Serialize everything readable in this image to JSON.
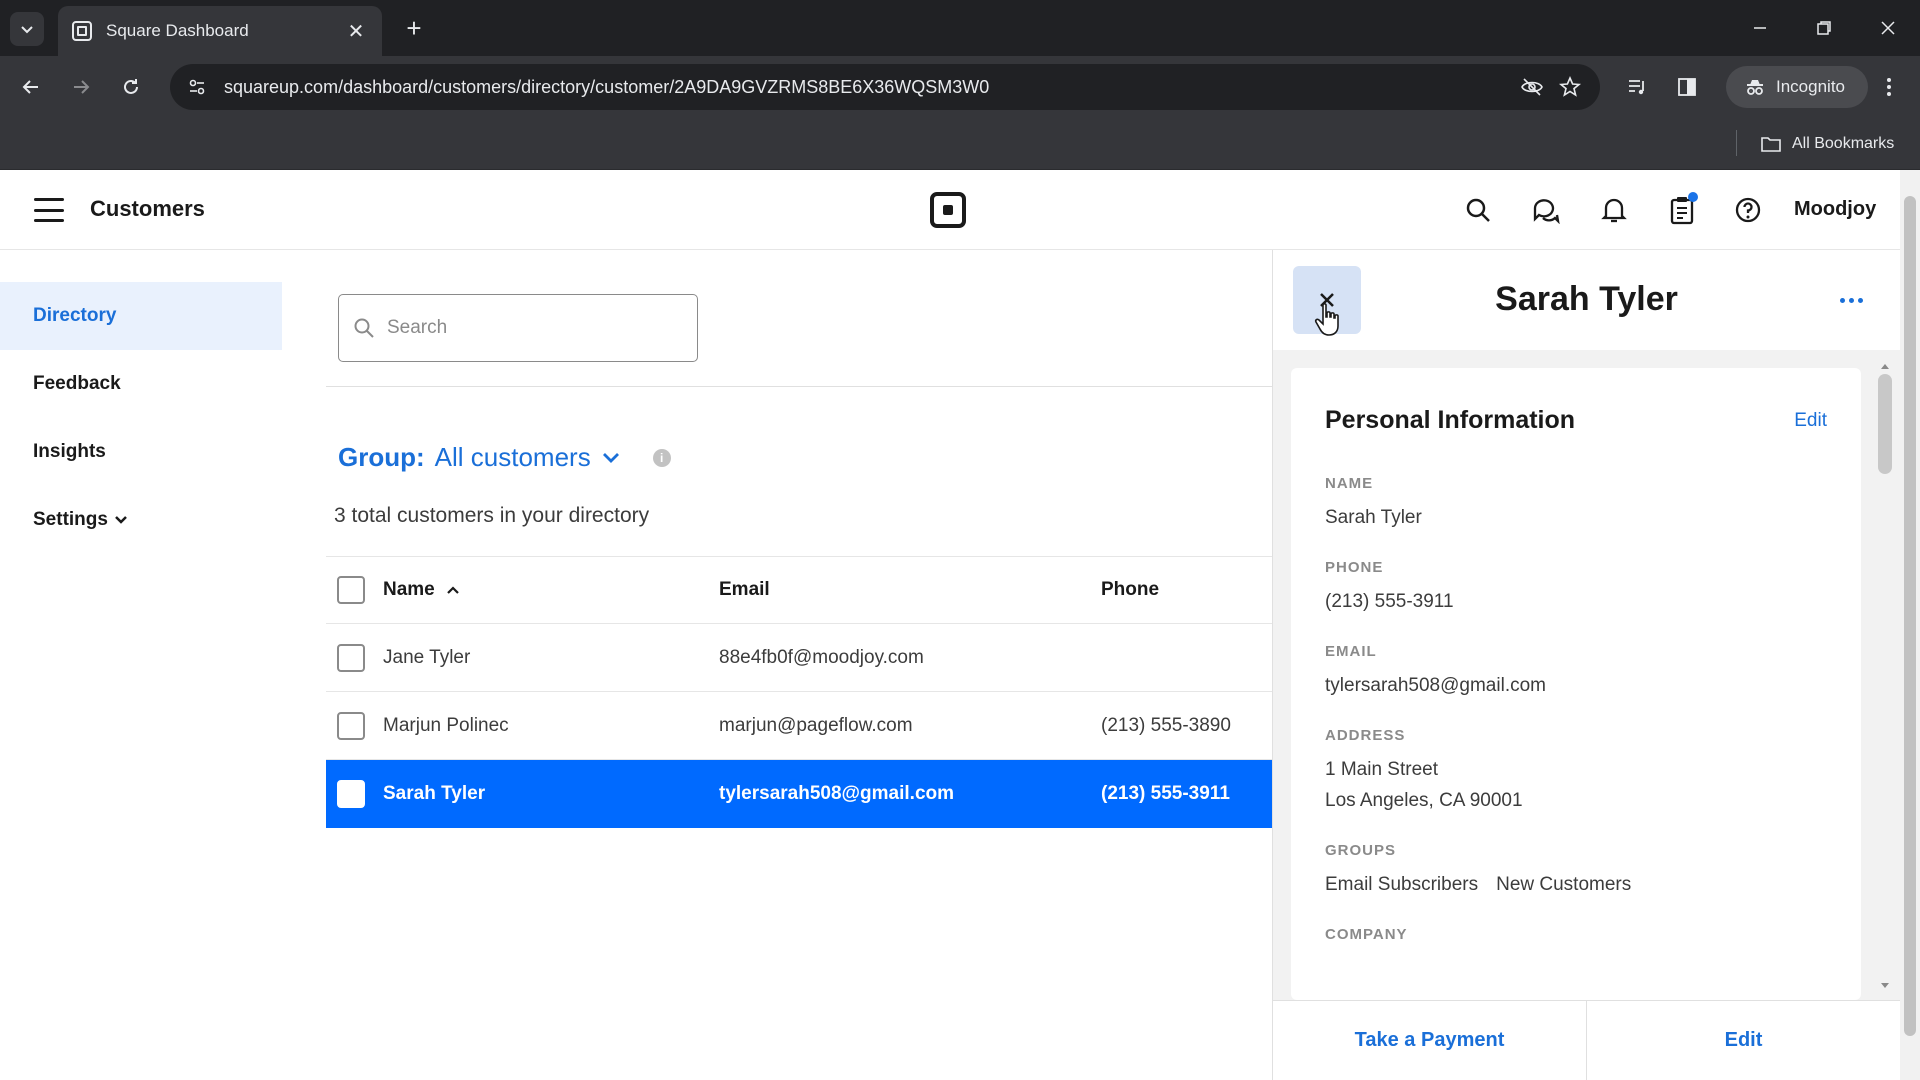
{
  "browser": {
    "tab_title": "Square Dashboard",
    "url": "squareup.com/dashboard/customers/directory/customer/2A9DA9GVZRMS8BE6X36WQSM3W0",
    "incognito_label": "Incognito",
    "bookmarks_label": "All Bookmarks"
  },
  "header": {
    "title": "Customers",
    "account": "Moodjoy",
    "icons": [
      "search-icon",
      "messages-icon",
      "bell-icon",
      "clipboard-icon",
      "help-icon"
    ]
  },
  "sidebar": {
    "items": [
      {
        "label": "Directory"
      },
      {
        "label": "Feedback"
      },
      {
        "label": "Insights"
      },
      {
        "label": "Settings"
      }
    ]
  },
  "main": {
    "search_placeholder": "Search",
    "group_label": "Group:",
    "group_value": "All customers",
    "total_text": "3 total customers in your directory",
    "columns": {
      "name": "Name",
      "email": "Email",
      "phone": "Phone"
    },
    "rows": [
      {
        "name": "Jane Tyler",
        "email": "88e4fb0f@moodjoy.com",
        "phone": ""
      },
      {
        "name": "Marjun Polinec",
        "email": "marjun@pageflow.com",
        "phone": "(213) 555-3890"
      },
      {
        "name": "Sarah Tyler",
        "email": "tylersarah508@gmail.com",
        "phone": "(213) 555-3911"
      }
    ]
  },
  "panel": {
    "title": "Sarah Tyler",
    "card_title": "Personal Information",
    "edit_label": "Edit",
    "name_label": "NAME",
    "name_value": "Sarah Tyler",
    "phone_label": "PHONE",
    "phone_value": "(213) 555-3911",
    "email_label": "EMAIL",
    "email_value": "tylersarah508@gmail.com",
    "address_label": "ADDRESS",
    "address_line1": "1 Main Street",
    "address_line2": "Los Angeles, CA 90001",
    "groups_label": "GROUPS",
    "groups": [
      "Email Subscribers",
      "New Customers"
    ],
    "company_label": "COMPANY",
    "footer_payment": "Take a Payment",
    "footer_edit": "Edit"
  },
  "colors": {
    "accent": "#006aff",
    "link": "#1a6fd8",
    "sidebar_active_bg": "#e9f1fd"
  }
}
